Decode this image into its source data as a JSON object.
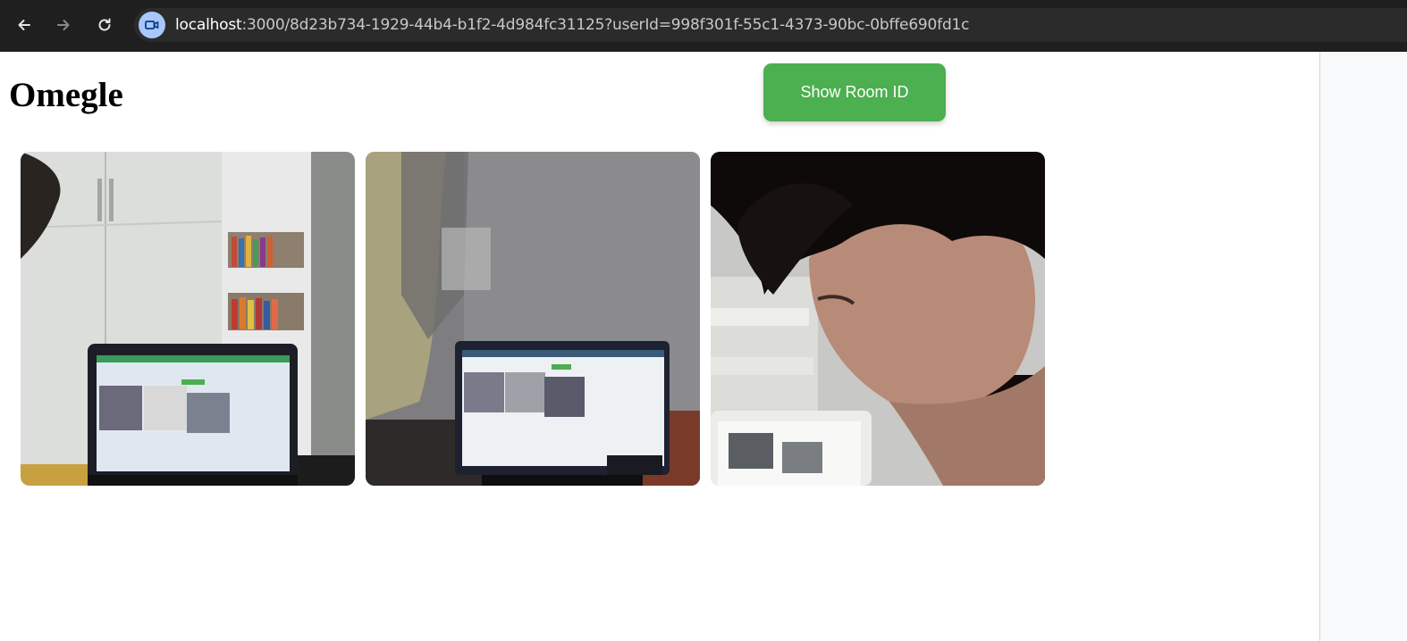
{
  "browser": {
    "url_host": "localhost",
    "url_rest": ":3000/8d23b734-1929-44b4-b1f2-4d984fc31125?userId=998f301f-55c1-4373-90bc-0bffe690fd1c",
    "back_icon": "arrow-left-icon",
    "forward_icon": "arrow-right-icon",
    "reload_icon": "reload-icon",
    "site_icon": "video-camera-icon"
  },
  "page": {
    "title": "Omegle",
    "room_button_label": "Show Room ID",
    "accent_color": "#4caf50"
  },
  "videos": [
    {
      "name": "local-video",
      "scene": "room with wardrobe and laptop"
    },
    {
      "name": "remote-video-1",
      "scene": "laptop on desk"
    },
    {
      "name": "remote-video-2",
      "scene": "person looking down at tablet"
    }
  ]
}
